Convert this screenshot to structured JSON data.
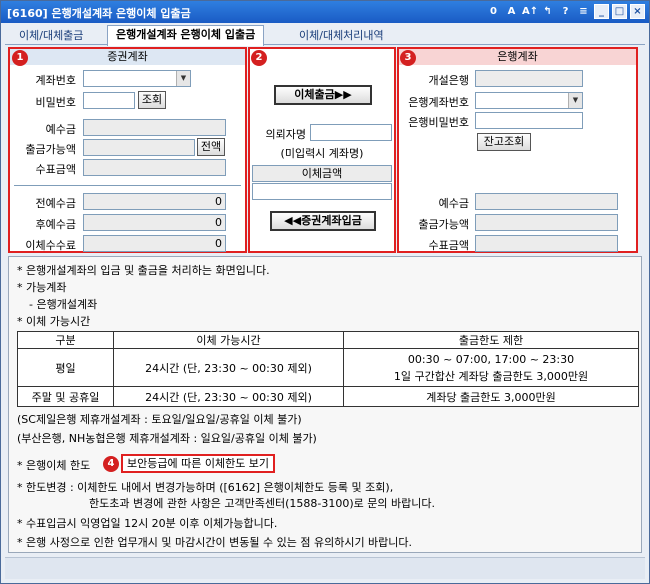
{
  "window": {
    "title": "[6160] 은행개설계좌 은행이체 입출금",
    "sys_icons": [
      "0",
      "A",
      "A↑",
      "↰",
      "?",
      "≡",
      "_",
      "□",
      "×"
    ]
  },
  "tabs": [
    {
      "label": "이체/대체출금"
    },
    {
      "label": "은행개설계좌 은행이체 입출금"
    },
    {
      "label": "이체/대체처리내역"
    }
  ],
  "markers": [
    "1",
    "2",
    "3",
    "4"
  ],
  "securities": {
    "header": "증권계좌",
    "account_label": "계좌번호",
    "password_label": "비밀번호",
    "query_button": "조회",
    "deposit_label": "예수금",
    "withdrawable_label": "출금가능액",
    "full_amount_button": "전액",
    "check_amount_label": "수표금액",
    "prev_deposit_label": "전예수금",
    "prev_deposit_value": "0",
    "after_deposit_label": "후예수금",
    "after_deposit_value": "0",
    "fee_label": "이체수수료",
    "fee_value": "0"
  },
  "transfer": {
    "withdraw_button": "이체출금▶▶",
    "requester_label": "의뢰자명",
    "requester_note": "(미입력시 계좌명)",
    "amount_header": "이체금액",
    "deposit_button": "◀◀증권계좌입금"
  },
  "bank": {
    "header": "은행계좌",
    "bank_label": "개설은행",
    "bank_account_label": "은행계좌번호",
    "bank_password_label": "은행비밀번호",
    "balance_button": "잔고조회",
    "deposit_label": "예수금",
    "withdrawable_label": "출금가능액",
    "check_amount_label": "수표금액"
  },
  "info": {
    "line1": "* 은행개설계좌의 입금 및 출금을 처리하는 화면입니다.",
    "line2": "* 가능계좌",
    "line3": "- 은행개설계좌",
    "line4": "* 이체 가능시간",
    "table": {
      "headers": [
        "구분",
        "이체 가능시간",
        "출금한도 제한"
      ],
      "rows": [
        {
          "type": "평일",
          "hours": "24시간 (단, 23:30 ~ 00:30 제외)",
          "limit1": "00:30 ~ 07:00, 17:00 ~ 23:30",
          "limit2": "1일 구간합산 계좌당 출금한도 3,000만원"
        },
        {
          "type": "주말 및 공휴일",
          "hours": "24시간 (단, 23:30 ~ 00:30 제외)",
          "limit1": "계좌당 출금한도 3,000만원",
          "limit2": ""
        }
      ]
    },
    "note1": "(SC제일은행 제휴개설계좌 : 토요일/일요일/공휴일 이체 불가)",
    "note2": "(부산은행, NH농협은행 제휴개설계좌 : 일요일/공휴일 이체 불가)",
    "limit_label": "* 은행이체 한도",
    "limit_link": "보안등급에 따른 이체한도 보기",
    "change1": "* 한도변경 : 이체한도 내에서 변경가능하며 ([6162] 은행이체한도 등록 및 조회),",
    "change2": "한도초과 변경에 관한 사항은 고객만족센터(1588-3100)로 문의 바랍니다.",
    "check_note": "* 수표입금시 익영업일 12시 20분 이후 이체가능합니다.",
    "bank_note": "* 은행 사정으로 인한 업무개시 및 마감시간이 변동될 수 있는 점 유의하시기 바랍니다."
  }
}
